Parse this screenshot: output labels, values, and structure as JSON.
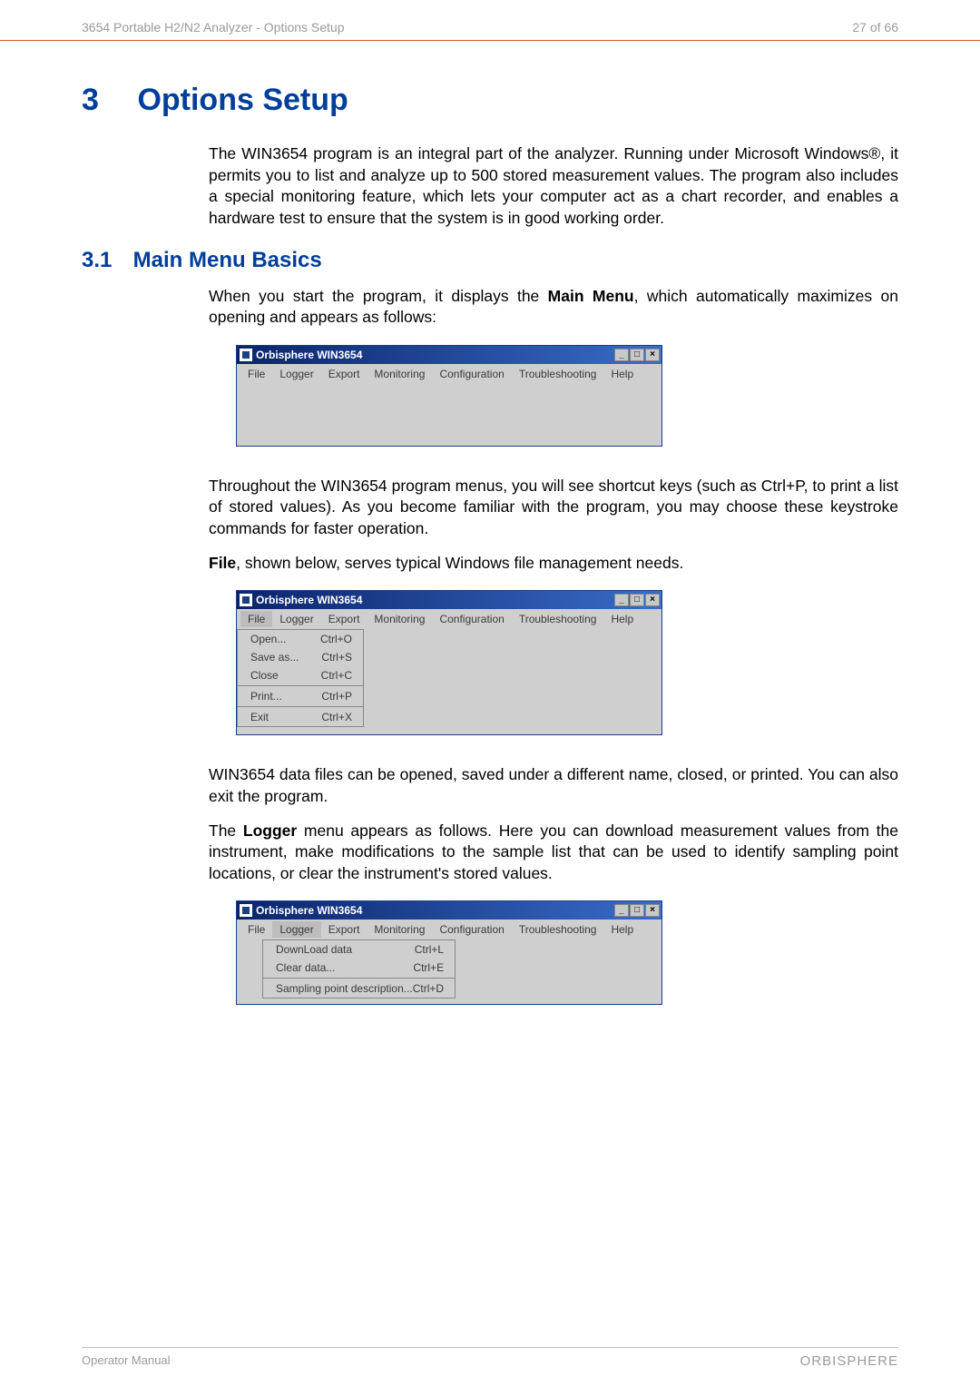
{
  "header": {
    "doc_title": "3654 Portable H2/N2 Analyzer - Options Setup",
    "page_no": "27 of 66"
  },
  "chapter": {
    "num": "3",
    "title": "Options Setup"
  },
  "para1": "The WIN3654 program is an integral part of the analyzer. Running under Microsoft Windows®, it permits you to list and analyze up to 500 stored measurement values. The program also includes a special monitoring feature, which lets your computer act as a chart recorder, and enables a hardware test to ensure that the system is in good working order.",
  "section1": {
    "num": "3.1",
    "title": "Main Menu Basics"
  },
  "para2a": "When you start the program, it displays the ",
  "para2b": "Main Menu",
  "para2c": ", which automatically maximizes on opening and appears as follows:",
  "win_title": "Orbisphere WIN3654",
  "menubar": {
    "file": "File",
    "logger": "Logger",
    "export": "Export",
    "monitoring": "Monitoring",
    "configuration": "Configuration",
    "troubleshooting": "Troubleshooting",
    "help": "Help"
  },
  "para3": "Throughout the WIN3654 program menus, you will see shortcut keys (such as Ctrl+P, to print a list of stored values). As you become familiar with the program, you may choose these keystroke commands for faster operation.",
  "para4a": "File",
  "para4b": ", shown below, serves typical Windows file management needs.",
  "file_menu": {
    "open": {
      "label": "Open...",
      "key": "Ctrl+O"
    },
    "saveas": {
      "label": "Save as...",
      "key": "Ctrl+S"
    },
    "close": {
      "label": "Close",
      "key": "Ctrl+C"
    },
    "print": {
      "label": "Print...",
      "key": "Ctrl+P"
    },
    "exit": {
      "label": "Exit",
      "key": "Ctrl+X"
    }
  },
  "para5": "WIN3654 data files can be opened, saved under a different name, closed, or printed. You can also exit the program.",
  "para6a": "The ",
  "para6b": "Logger",
  "para6c": " menu appears as follows. Here you can download measurement values from the instrument, make modifications to the sample list that can be used to identify sampling point locations, or clear the instrument's stored values.",
  "logger_menu": {
    "download": {
      "label": "DownLoad data",
      "key": "Ctrl+L"
    },
    "clear": {
      "label": "Clear data...",
      "key": "Ctrl+E"
    },
    "sampling": {
      "label": "Sampling point description...",
      "key": "Ctrl+D"
    }
  },
  "win_controls": {
    "min": "_",
    "max": "□",
    "close": "×"
  },
  "footer": {
    "left": "Operator Manual",
    "right": "ORBISPHERE"
  }
}
